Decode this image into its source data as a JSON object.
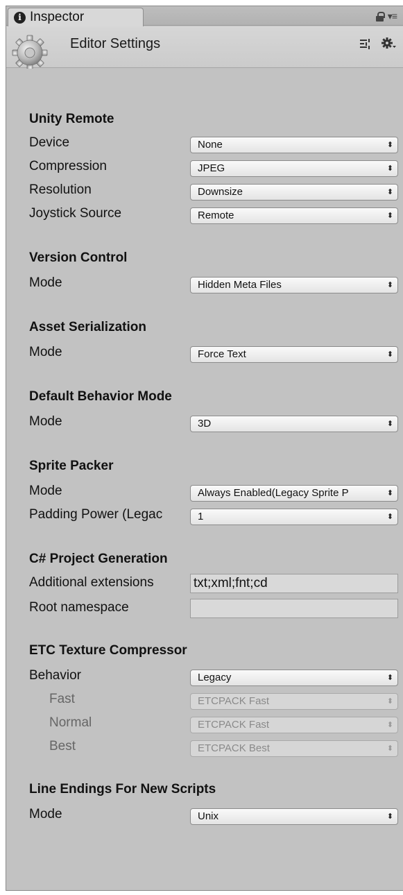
{
  "tab": {
    "title": "Inspector"
  },
  "header": {
    "title": "Editor Settings"
  },
  "sections": {
    "unity_remote": {
      "title": "Unity Remote",
      "device_label": "Device",
      "device_value": "None",
      "compression_label": "Compression",
      "compression_value": "JPEG",
      "resolution_label": "Resolution",
      "resolution_value": "Downsize",
      "joystick_label": "Joystick Source",
      "joystick_value": "Remote"
    },
    "version_control": {
      "title": "Version Control",
      "mode_label": "Mode",
      "mode_value": "Hidden Meta Files"
    },
    "asset_serialization": {
      "title": "Asset Serialization",
      "mode_label": "Mode",
      "mode_value": "Force Text"
    },
    "default_behavior": {
      "title": "Default Behavior Mode",
      "mode_label": "Mode",
      "mode_value": "3D"
    },
    "sprite_packer": {
      "title": "Sprite Packer",
      "mode_label": "Mode",
      "mode_value": "Always Enabled(Legacy Sprite P",
      "padding_label": "Padding Power (Legac",
      "padding_value": "1"
    },
    "csharp": {
      "title": "C# Project Generation",
      "extensions_label": "Additional extensions",
      "extensions_value": "txt;xml;fnt;cd",
      "namespace_label": "Root namespace",
      "namespace_value": ""
    },
    "etc": {
      "title": "ETC Texture Compressor",
      "behavior_label": "Behavior",
      "behavior_value": "Legacy",
      "fast_label": "Fast",
      "fast_value": "ETCPACK Fast",
      "normal_label": "Normal",
      "normal_value": "ETCPACK Fast",
      "best_label": "Best",
      "best_value": "ETCPACK Best"
    },
    "line_endings": {
      "title": "Line Endings For New Scripts",
      "mode_label": "Mode",
      "mode_value": "Unix"
    }
  },
  "popup_arrows": "⬍",
  "icons": {
    "info": "info-icon",
    "lock": "lock-icon",
    "menu": "menu-icon",
    "settings_gear": "gear-icon",
    "preset": "preset-icon",
    "header_gear": "gear-dropdown-icon"
  }
}
